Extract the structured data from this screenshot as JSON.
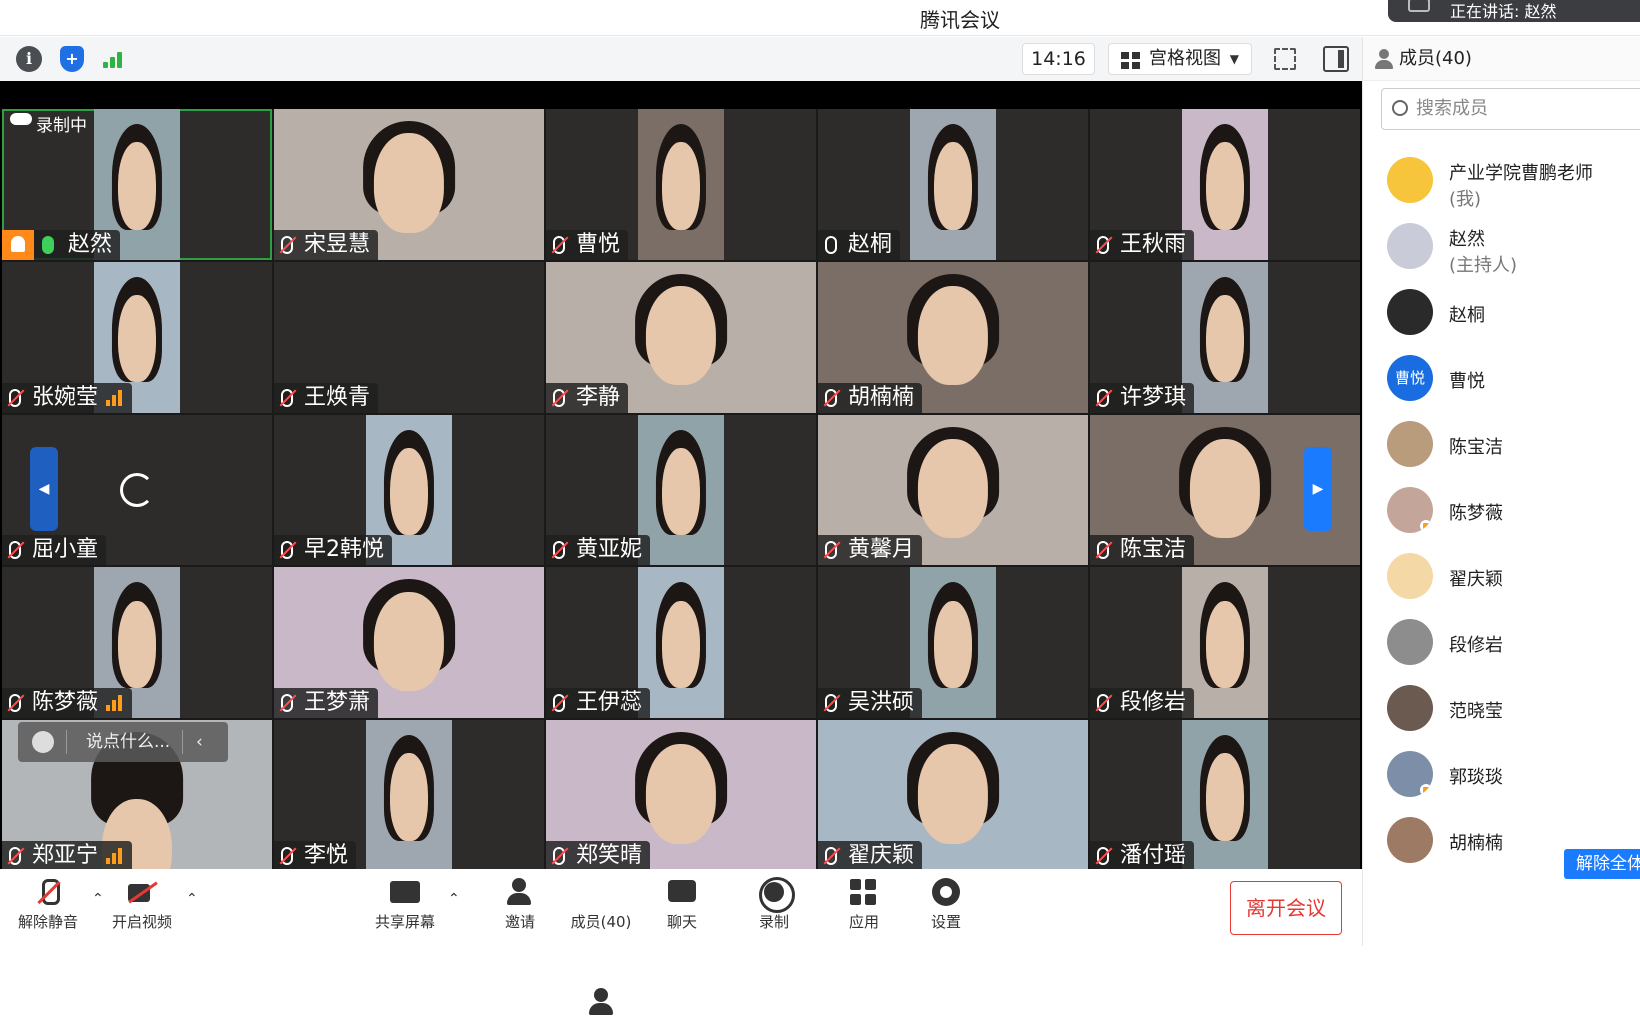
{
  "app": {
    "title": "腾讯会议",
    "speaking_banner": "正在讲话: 赵然"
  },
  "toolbar": {
    "timer": "14:16",
    "view_mode": "宫格视图"
  },
  "recording_label": "录制中",
  "chat_input": {
    "placeholder": "说点什么..."
  },
  "participants": [
    {
      "name": "赵然",
      "muted": false,
      "host": true,
      "active_speaker": true,
      "recording": true
    },
    {
      "name": "宋昱慧",
      "muted": true,
      "wide": true
    },
    {
      "name": "曹悦",
      "muted": true
    },
    {
      "name": "赵桐",
      "muted": false
    },
    {
      "name": "王秋雨",
      "muted": true
    },
    {
      "name": "张婉莹",
      "muted": true,
      "weak_signal": true
    },
    {
      "name": "王焕青",
      "muted": true,
      "no_video": true
    },
    {
      "name": "李静",
      "muted": true,
      "wide": true
    },
    {
      "name": "胡楠楠",
      "muted": true,
      "wide": true
    },
    {
      "name": "许梦琪",
      "muted": true
    },
    {
      "name": "屈小童",
      "muted": true,
      "loading": true
    },
    {
      "name": "早2韩悦",
      "muted": true
    },
    {
      "name": "黄亚妮",
      "muted": true
    },
    {
      "name": "黄馨月",
      "muted": true,
      "wide": true
    },
    {
      "name": "陈宝洁",
      "muted": true,
      "wide": true
    },
    {
      "name": "陈梦薇",
      "muted": true,
      "weak_signal": true
    },
    {
      "name": "王梦萧",
      "muted": true,
      "wide": true
    },
    {
      "name": "王伊蕊",
      "muted": true
    },
    {
      "name": "吴洪硕",
      "muted": true
    },
    {
      "name": "段修岩",
      "muted": true
    },
    {
      "name": "郑亚宁",
      "muted": true,
      "weak_signal": true,
      "chat_overlay": true
    },
    {
      "name": "李悦",
      "muted": true
    },
    {
      "name": "郑笑晴",
      "muted": true,
      "wide": true
    },
    {
      "name": "翟庆颖",
      "muted": true,
      "wide": true
    },
    {
      "name": "潘付瑶",
      "muted": true
    }
  ],
  "controls": {
    "unmute": "解除静音",
    "start_video": "开启视频",
    "share_screen": "共享屏幕",
    "invite": "邀请",
    "members": "成员(40)",
    "chat": "聊天",
    "record": "录制",
    "apps": "应用",
    "settings": "设置",
    "leave": "离开会议"
  },
  "panel": {
    "title": "成员(40)",
    "search_placeholder": "搜索成员",
    "unmute_all": "解除全体静音",
    "members": [
      {
        "name": "产业学院曹鹏老师",
        "role": "(我)",
        "avatar_color": "#f6c53b"
      },
      {
        "name": "赵然",
        "role": "(主持人)",
        "avatar_color": "#c9ccd8"
      },
      {
        "name": "赵桐",
        "avatar_color": "#2a2a2a"
      },
      {
        "name": "曹悦",
        "avatar_color": "#1a6de0",
        "initials": "曹悦"
      },
      {
        "name": "陈宝洁",
        "avatar_color": "#b89c7c"
      },
      {
        "name": "陈梦薇",
        "avatar_color": "#c4a59a",
        "weak_signal": true
      },
      {
        "name": "翟庆颖",
        "avatar_color": "#f4d9a7"
      },
      {
        "name": "段修岩",
        "avatar_color": "#8d8d8d"
      },
      {
        "name": "范晓莹",
        "avatar_color": "#6b5a50"
      },
      {
        "name": "郭琰琰",
        "avatar_color": "#7d8fa8",
        "weak_signal": true
      },
      {
        "name": "胡楠楠",
        "avatar_color": "#9d7a63"
      }
    ]
  },
  "colors": {
    "accent": "#1a7bff",
    "danger": "#e53935",
    "active_border": "#2ea043",
    "tile_bg": "#2e2c2b"
  }
}
